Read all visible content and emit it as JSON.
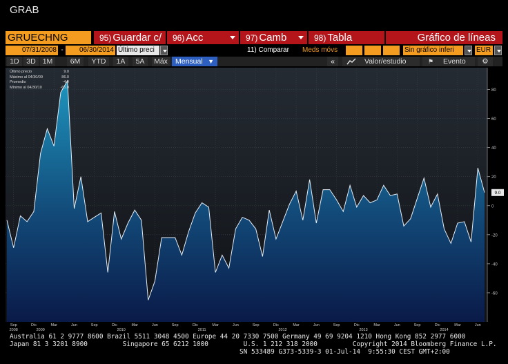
{
  "window": {
    "title": "GRAB"
  },
  "toolbar": {
    "ticker": "GRUECHNG Index",
    "buttons": [
      {
        "num": "95)",
        "label": "Guardar c/"
      },
      {
        "num": "96)",
        "label": "Acc"
      },
      {
        "num": "97)",
        "label": "Camb"
      },
      {
        "num": "98)",
        "label": "Tabla"
      }
    ],
    "chart_type": "Gráfico de líneas"
  },
  "params": {
    "start_date": "07/31/2008",
    "end_date": "06/30/2014",
    "price_field": "Último preci",
    "compare": "11) Comparar",
    "moving_avg": "Meds móvs",
    "chart_option": "Sin gráfico inferi",
    "currency": "EUR"
  },
  "periods": [
    "1D",
    "3D",
    "1M",
    "6M",
    "YTD",
    "1A",
    "5A",
    "Máx"
  ],
  "frequency": "Mensual",
  "actions": {
    "value_study": "Valor/estudio",
    "event": "Evento"
  },
  "legend": [
    {
      "label": "Último precio",
      "value": "9.0"
    },
    {
      "label": "Máximo al 04/30/09",
      "value": "86.0"
    },
    {
      "label": "Promedio",
      "value": "-4.4"
    },
    {
      "label": "Mínimo al 04/30/10",
      "value": "-65.0"
    }
  ],
  "chart_data": {
    "type": "area",
    "series": [
      {
        "values": [
          -10,
          -29,
          -7,
          -11,
          -4,
          36,
          53,
          41,
          78,
          86,
          -2,
          20,
          -11,
          -8,
          -5,
          -46,
          -4,
          -23,
          -12,
          -3,
          -10,
          -65,
          -52,
          -22,
          -22,
          -22,
          -34,
          -18,
          -5,
          2,
          -1,
          -46,
          -34,
          -43,
          -16,
          -8,
          -10,
          -16,
          -35,
          -3,
          -23,
          -11,
          1,
          10,
          -10,
          18,
          -12,
          11,
          11,
          4,
          -4,
          14,
          -1,
          7,
          2,
          4,
          14,
          7,
          8,
          -14,
          -9,
          5,
          19,
          -1,
          8,
          -16,
          -26,
          -12,
          -11,
          -25,
          26,
          9
        ]
      }
    ],
    "x_tick_labels": [
      "Sep",
      "Dic",
      "Mar",
      "Jun",
      "Sep",
      "Dic",
      "Mar",
      "Jun",
      "Sep",
      "Dic",
      "Mar",
      "Jun",
      "Sep",
      "Dic",
      "Mar",
      "Jun",
      "Sep",
      "Dic",
      "Mar",
      "Jun",
      "Sep",
      "Dic",
      "Mar",
      "Jun"
    ],
    "year_labels": [
      "2008",
      "2009",
      "2010",
      "2011",
      "2012",
      "2013",
      "2014"
    ],
    "y_ticks": [
      80,
      60,
      40,
      20,
      0,
      -20,
      -40,
      -60
    ],
    "ylim": [
      -80,
      95
    ],
    "last_value_tag": "9.0",
    "grid": true,
    "legend_position": "top-left"
  },
  "footer": {
    "line1": "Australia 61 2 9777 8600 Brazil 5511 3048 4500 Europe 44 20 7330 7500 Germany 49 69 9204 1210 Hong Kong 852 2977 6000",
    "line2": "Japan 81 3 3201 8900         Singapore 65 6212 1000         U.S. 1 212 318 2000         Copyright 2014 Bloomberg Finance L.P.",
    "line3": "                                                           SN 533489 G373-5339-3 01-Jul-14  9:55:30 CEST GMT+2:00"
  },
  "colors": {
    "accent": "#f39c1f",
    "button_red": "#b3151b",
    "line": "#e6eef6",
    "area_top": "#1d8db5",
    "area_bottom": "#0a1d4a"
  }
}
